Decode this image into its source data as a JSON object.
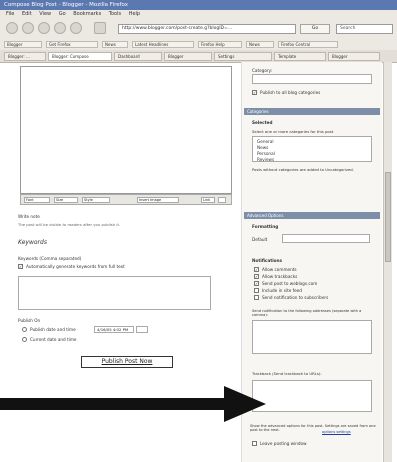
{
  "window": {
    "title": "Compose Blog Post - Blogger - Mozilla Firefox"
  },
  "menu": [
    "File",
    "Edit",
    "View",
    "Go",
    "Bookmarks",
    "Tools",
    "Help"
  ],
  "toolbar": {
    "url": "http://www.blogger.com/post-create.g?blogID=...",
    "go_label": "Go",
    "search_placeholder": "Search"
  },
  "bookmarks": [
    "Blogger",
    "Get Firefox",
    "News",
    "Latest Headlines",
    "Firefox Help",
    "News",
    "Firefox Central"
  ],
  "tabs": [
    {
      "label": "Blogger: ...",
      "active": false
    },
    {
      "label": "Blogger: Compose",
      "active": true
    },
    {
      "label": "Dashboard",
      "active": false
    },
    {
      "label": "Blogger",
      "active": false
    },
    {
      "label": "Settings",
      "active": false
    },
    {
      "label": "Template",
      "active": false
    },
    {
      "label": "Blogger",
      "active": false
    }
  ],
  "editor": {
    "toolbar_buttons": [
      "Font",
      "Size",
      "Style",
      "Insert Image",
      "Link"
    ],
    "note": "Write note",
    "note_detail": "The post will be visible to readers after you publish it.",
    "keywords_title": "Keywords",
    "keywords_label": "Keywords (Comma separated)",
    "keywords_checkbox": "Automatically generate keywords from full text",
    "time_label": "Publish On",
    "time_radio1": "Publish date and time",
    "time_radio1_value": "4/16/05 4:02 PM",
    "time_radio2": "Current date and time",
    "publish_button": "Publish Post Now"
  },
  "sidebar": {
    "category_label": "Category:",
    "category_checkbox": "Publish to all blog categories",
    "categories_head": "Categories",
    "categories_sub": "Selected",
    "categories_hint": "Select one or more categories for this post",
    "categories_list": [
      "General",
      "News",
      "Personal",
      "Reviews"
    ],
    "categories_note": "Posts without categories are added to Uncategorized.",
    "advanced_head": "Advanced Options",
    "formatting_label": "Formatting",
    "formatting_select": "Default",
    "notifications_label": "Notifications",
    "notify_items": [
      "Allow comments",
      "Allow trackbacks",
      "Send post to weblogs.com",
      "Include in site feed",
      "Send notification to subscribers"
    ],
    "ping_label": "Send notification to the following addresses (separate with a comma):",
    "trackback_label": "Trackback (Send trackback to URLs):",
    "footer_note": "Show the advanced options for this post. Settings are saved from one post to the next.",
    "footer_link": "options settings",
    "footer_checkbox": "Leave posting window"
  },
  "colors": {
    "titlebar": "#5b78b0",
    "panel_head": "#7d8fa8",
    "arrow": "#111111"
  }
}
